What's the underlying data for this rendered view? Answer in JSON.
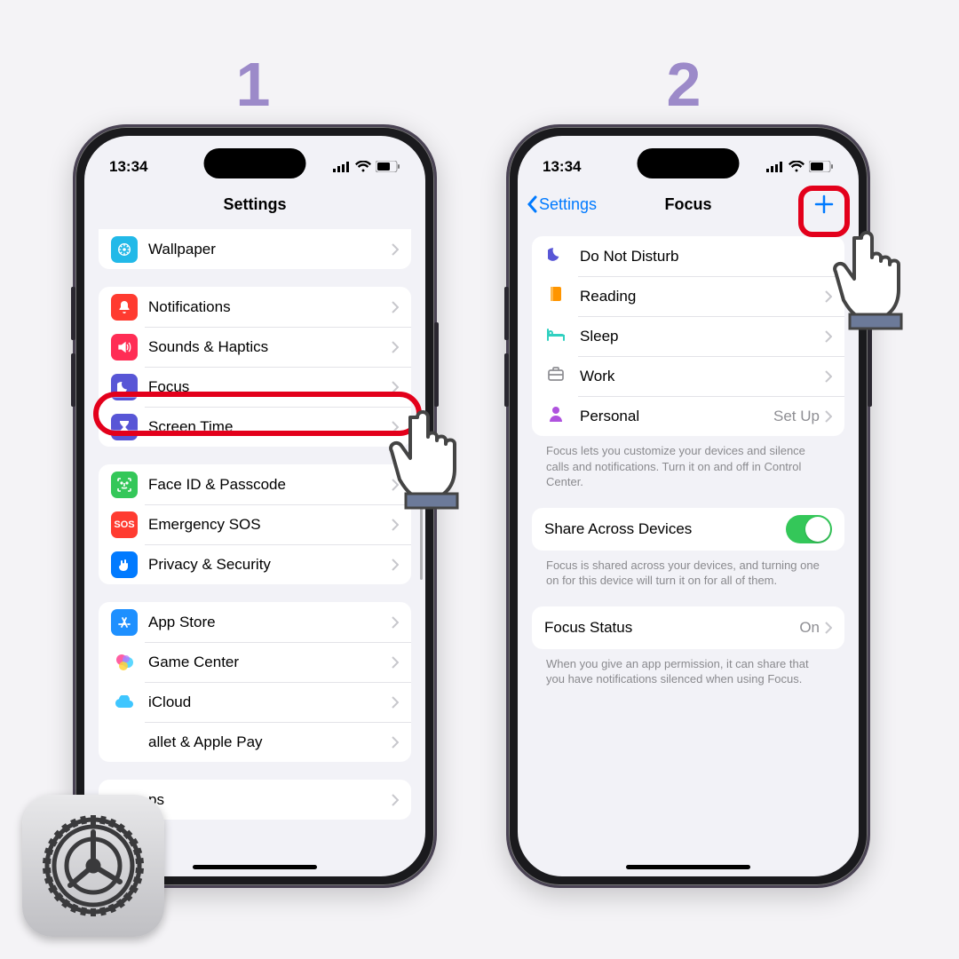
{
  "steps": {
    "one": "1",
    "two": "2"
  },
  "status": {
    "time": "13:34"
  },
  "phone1": {
    "title": "Settings",
    "groups": {
      "g0": {
        "wallpaper": "Wallpaper"
      },
      "g1": {
        "notifications": "Notifications",
        "sounds": "Sounds & Haptics",
        "focus": "Focus",
        "screentime": "Screen Time"
      },
      "g2": {
        "faceid": "Face ID & Passcode",
        "sos": "Emergency SOS",
        "privacy": "Privacy & Security"
      },
      "g3": {
        "appstore": "App Store",
        "gamecenter": "Game Center",
        "icloud": "iCloud",
        "wallet": "allet & Apple Pay"
      },
      "g4": {
        "cut": "ps"
      }
    }
  },
  "phone2": {
    "back": "Settings",
    "title": "Focus",
    "list": {
      "dnd": "Do Not Disturb",
      "reading": "Reading",
      "sleep": "Sleep",
      "work": "Work",
      "personal": "Personal",
      "personal_detail": "Set Up"
    },
    "footer1": "Focus lets you customize your devices and silence calls and notifications. Turn it on and off in Control Center.",
    "share": {
      "label": "Share Across Devices"
    },
    "footer2": "Focus is shared across your devices, and turning one on for this device will turn it on for all of them.",
    "status": {
      "label": "Focus Status",
      "value": "On"
    },
    "footer3": "When you give an app permission, it can share that you have notifications silenced when using Focus."
  }
}
